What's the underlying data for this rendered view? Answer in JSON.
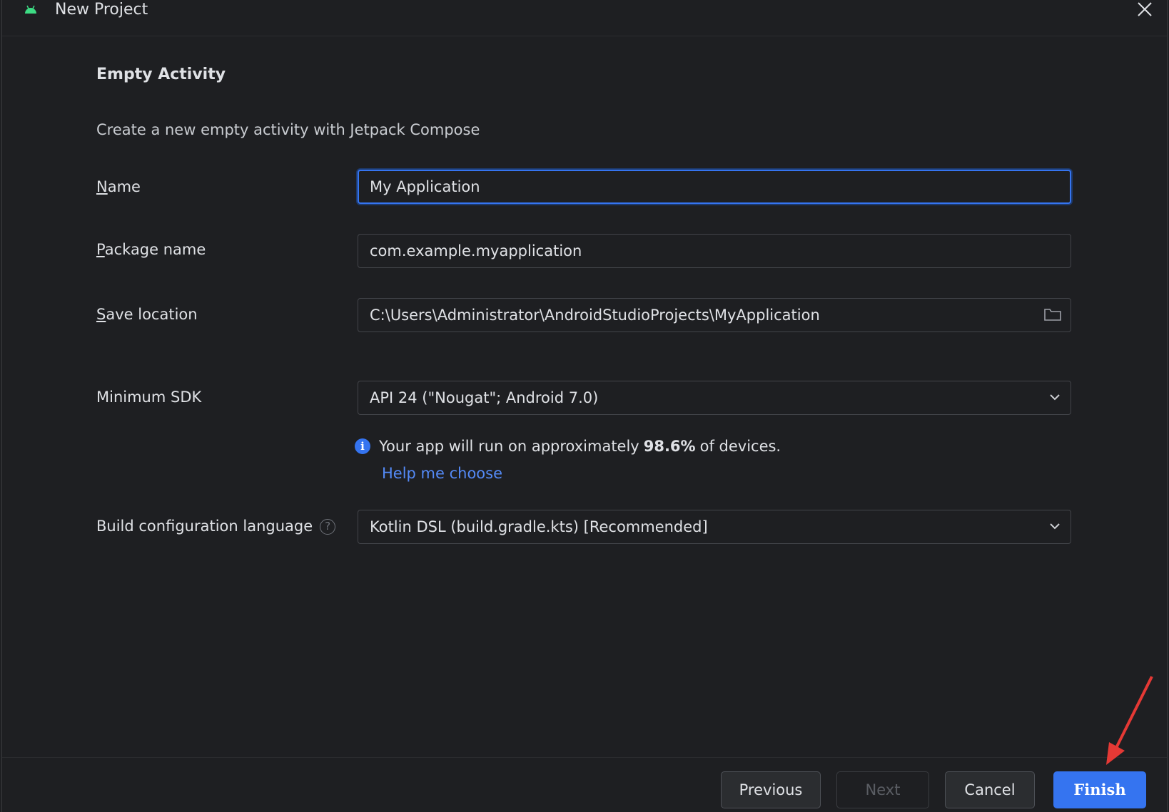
{
  "window": {
    "title": "New Project",
    "close_label": "×"
  },
  "section": {
    "title": "Empty Activity",
    "description": "Create a new empty activity with Jetpack Compose"
  },
  "form": {
    "name": {
      "label_accel": "N",
      "label_rest": "ame",
      "value": "My Application"
    },
    "package": {
      "label_accel": "P",
      "label_rest": "ackage name",
      "value": "com.example.myapplication"
    },
    "save_location": {
      "label_accel": "S",
      "label_rest": "ave location",
      "value": "C:\\Users\\Administrator\\AndroidStudioProjects\\MyApplication"
    },
    "min_sdk": {
      "label": "Minimum SDK",
      "value": "API 24 (\"Nougat\"; Android 7.0)"
    },
    "sdk_info": {
      "prefix": "Your app will run on approximately",
      "percent": "98.6%",
      "suffix": "of devices.",
      "help_link": "Help me choose"
    },
    "build_lang": {
      "label": "Build configuration language",
      "help_glyph": "?",
      "value": "Kotlin DSL (build.gradle.kts) [Recommended]"
    }
  },
  "buttons": {
    "previous": "Previous",
    "next": "Next",
    "cancel": "Cancel",
    "finish": "Finish"
  },
  "colors": {
    "accent": "#3574f0",
    "link": "#548af7",
    "background": "#1e1f22",
    "annotation_arrow": "#e53935"
  },
  "icons": {
    "app": "android-icon",
    "close": "close-icon",
    "folder": "folder-icon",
    "dropdown": "chevron-down-icon",
    "info": "info-icon",
    "help": "help-icon"
  }
}
